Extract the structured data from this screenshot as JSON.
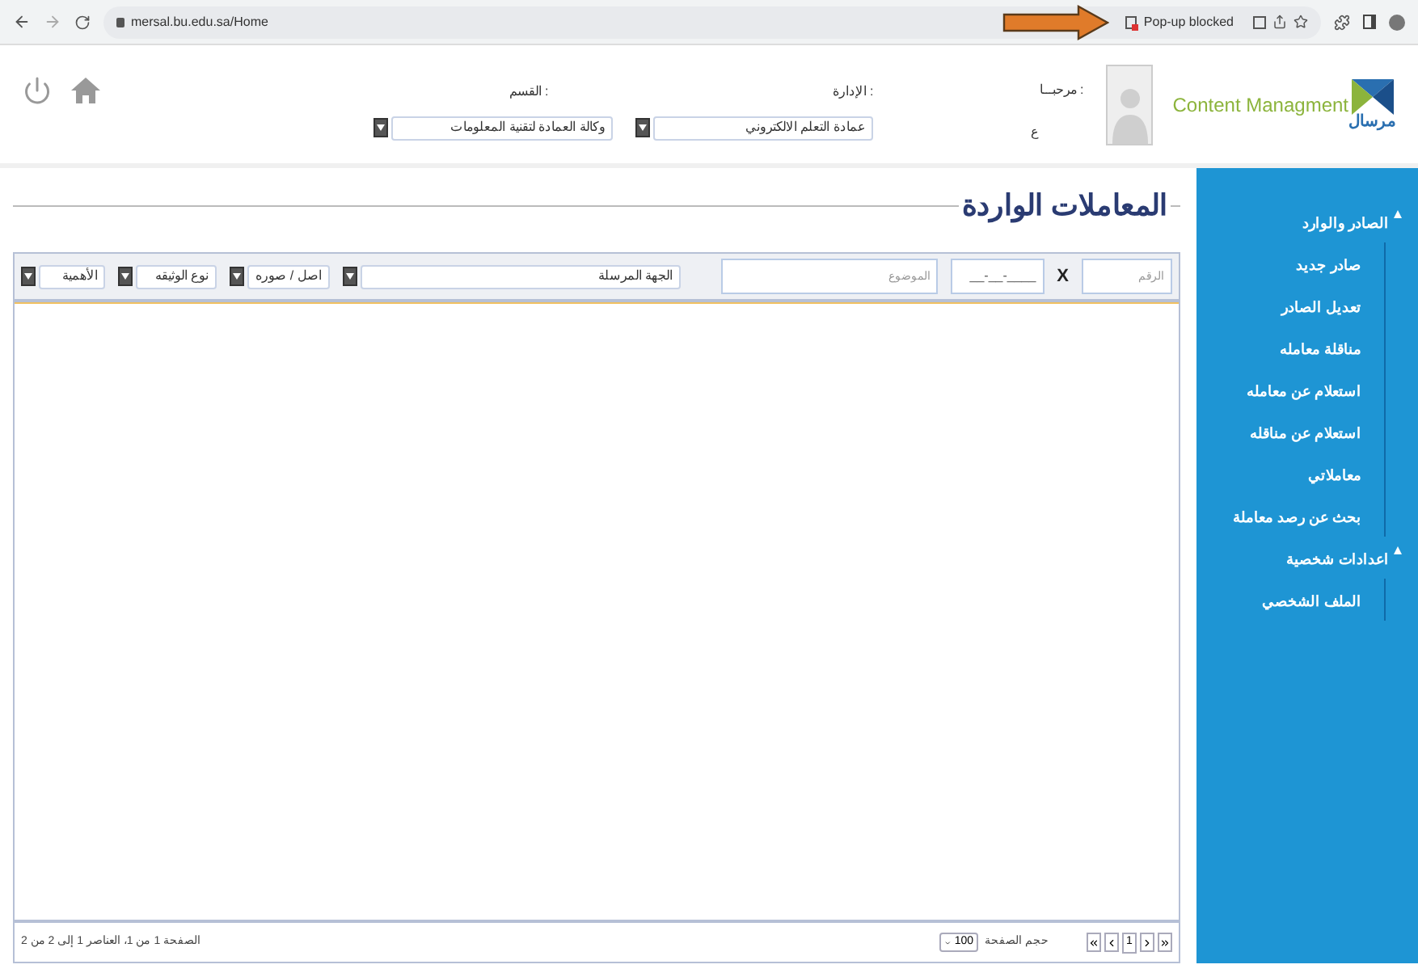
{
  "browser": {
    "url": "mersal.bu.edu.sa/Home",
    "notice": "Pop-up blocked"
  },
  "header": {
    "logo_text": "Content Managment",
    "logo_arabic": "مرسال",
    "welcome": "مرحبـــا :",
    "user": "ع",
    "department": {
      "label": "الإدارة :",
      "value": "عمادة التعلم الالكتروني"
    },
    "section": {
      "label": "القسم :",
      "value": "وكالة العمادة لتقنية المعلومات"
    }
  },
  "page_title": "المعاملات الواردة",
  "filters": {
    "number": {
      "placeholder": "الرقم"
    },
    "clear": "X",
    "date": {
      "value": "__-__-____"
    },
    "subject": {
      "placeholder": "الموضوع"
    },
    "dropdowns": [
      {
        "value": "الجهة المرسلة"
      },
      {
        "value": "اصل / صوره"
      },
      {
        "value": "نوع الوثيقه"
      },
      {
        "value": "الأهمية"
      }
    ]
  },
  "pager": {
    "page": "1",
    "page_size_label": "حجم الصفحة",
    "page_size": "100",
    "status": "الصفحة 1 من 1، العناصر 1 إلى 2 من 2"
  },
  "sidebar": {
    "items": [
      {
        "label": "الصادر والوارد",
        "expanded": true,
        "children": [
          {
            "label": "صادر جديد"
          },
          {
            "label": "تعديل الصادر"
          },
          {
            "label": "مناقلة معامله"
          },
          {
            "label": "استعلام عن معامله"
          },
          {
            "label": "استعلام عن مناقله"
          },
          {
            "label": "معاملاتي"
          },
          {
            "label": "بحث عن رصد معاملة"
          }
        ]
      },
      {
        "label": "اعدادات شخصية",
        "expanded": true,
        "children": [
          {
            "label": "الملف الشخصي"
          }
        ]
      }
    ]
  }
}
